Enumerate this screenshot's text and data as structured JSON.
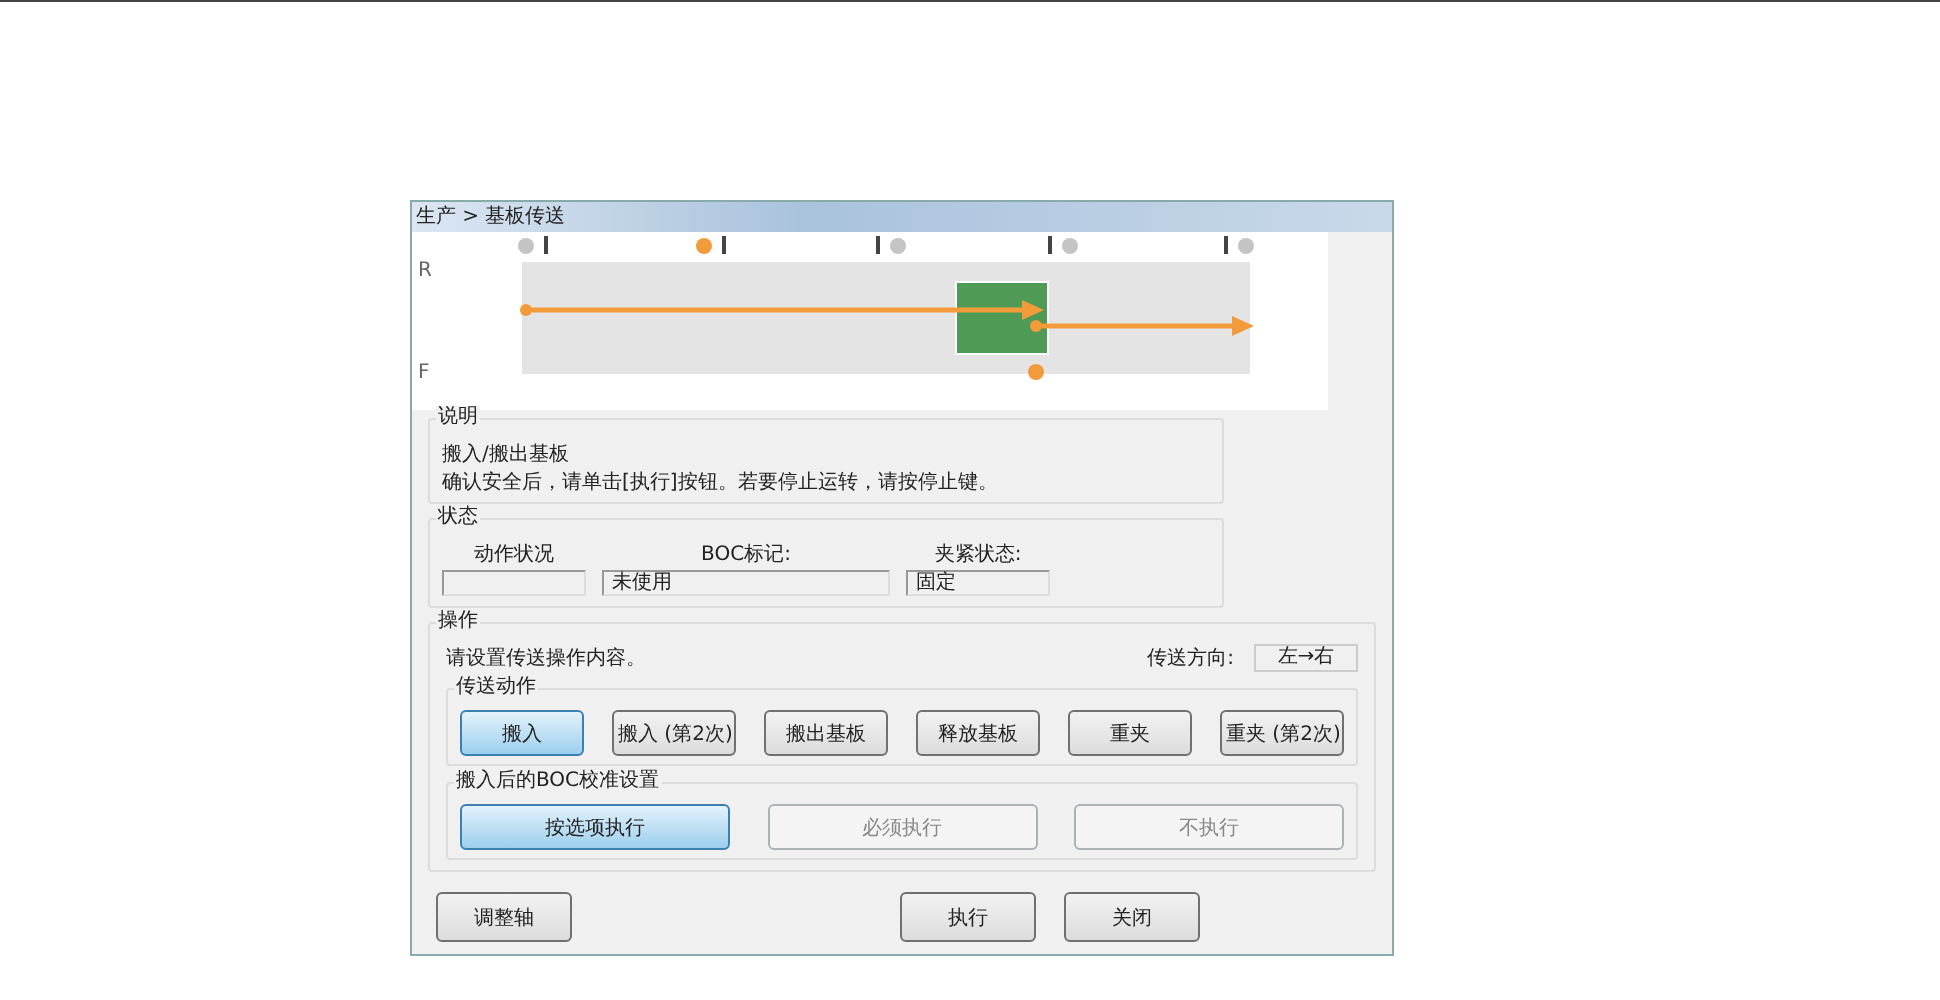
{
  "window": {
    "title": "生产 > 基板传送"
  },
  "diagram": {
    "row_labels": [
      "R",
      "F"
    ],
    "sensors": [
      {
        "on": false
      },
      {
        "on": true
      },
      {
        "on": false
      },
      {
        "on": false
      },
      {
        "on": false
      }
    ],
    "bottom_sensor": {
      "on": true
    }
  },
  "description": {
    "title": "说明",
    "lines": [
      "搬入/搬出基板",
      "确认安全后，请单击[执行]按钮。若要停止运转，请按停止键。"
    ]
  },
  "status": {
    "title": "状态",
    "fields": [
      {
        "label": "动作状况"
      },
      {
        "label": "BOC标记:",
        "value": "未使用"
      },
      {
        "label": "夹紧状态:",
        "value": "固定"
      }
    ]
  },
  "operation": {
    "title": "操作",
    "hint": "请设置传送操作内容。",
    "direction_label": "传送方向:",
    "direction_value": "左→右",
    "actions": {
      "title": "传送动作",
      "buttons": [
        {
          "label": "搬入",
          "selected": true
        },
        {
          "label": "搬入 (第2次)",
          "selected": false
        },
        {
          "label": "搬出基板",
          "selected": false
        },
        {
          "label": "释放基板",
          "selected": false
        },
        {
          "label": "重夹",
          "selected": false
        },
        {
          "label": "重夹 (第2次)",
          "selected": false
        }
      ]
    },
    "boc": {
      "title": "搬入后的BOC校准设置",
      "buttons": [
        {
          "label": "按选项执行",
          "selected": true
        },
        {
          "label": "必须执行",
          "selected": false
        },
        {
          "label": "不执行",
          "selected": false
        }
      ]
    }
  },
  "buttons": [
    "调整轴",
    "执行",
    "关闭"
  ]
}
